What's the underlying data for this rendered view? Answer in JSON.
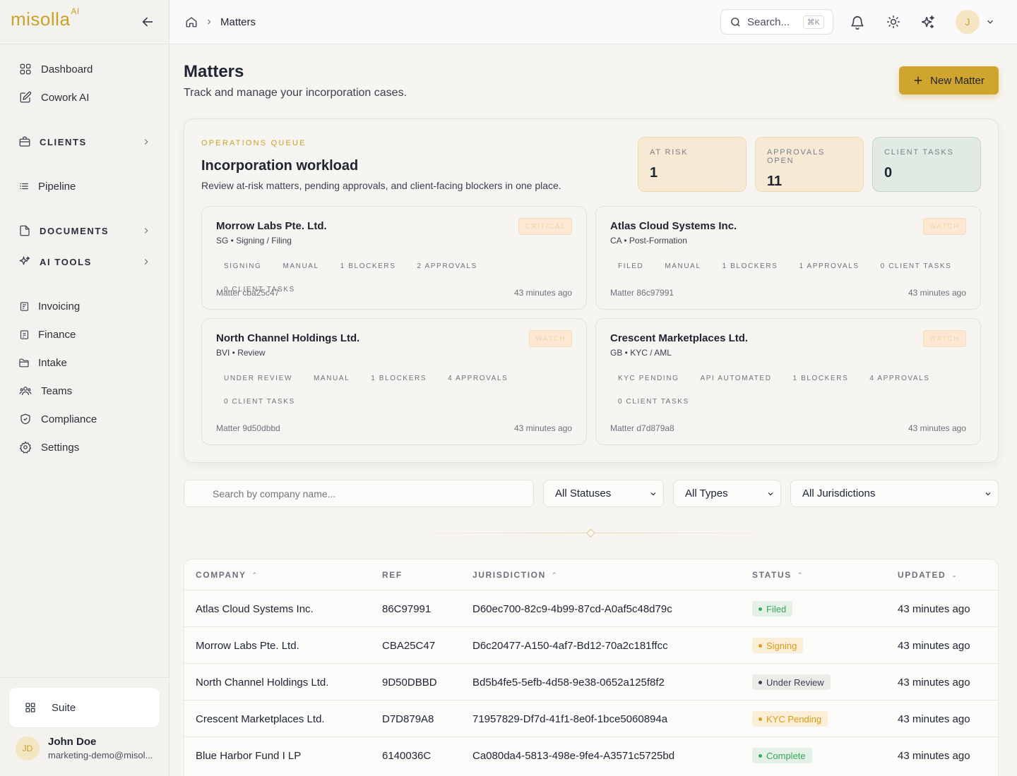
{
  "app": {
    "logo": "misolla",
    "logo_sup": "AI"
  },
  "sidebar": {
    "items": [
      {
        "label": "Dashboard",
        "icon": "grid-icon"
      },
      {
        "label": "Cowork AI",
        "icon": "pencil-square-icon"
      }
    ],
    "sections": [
      {
        "label": "CLIENTS",
        "icon": "briefcase-icon"
      },
      {
        "label": "DOCUMENTS",
        "icon": "document-icon"
      },
      {
        "label": "AI TOOLS",
        "icon": "sparkles-icon"
      }
    ],
    "pipeline": "Pipeline",
    "lower_items": [
      {
        "label": "Invoicing",
        "icon": "invoice-icon"
      },
      {
        "label": "Finance",
        "icon": "finance-icon"
      },
      {
        "label": "Intake",
        "icon": "folder-icon"
      },
      {
        "label": "Teams",
        "icon": "users-icon"
      },
      {
        "label": "Compliance",
        "icon": "shield-icon"
      },
      {
        "label": "Settings",
        "icon": "gear-icon"
      }
    ],
    "suite": "Suite",
    "user": {
      "initials": "JD",
      "name": "John Doe",
      "email": "marketing-demo@misol..."
    }
  },
  "topbar": {
    "breadcrumb": "Matters",
    "search_placeholder": "Search...",
    "search_kbd": "⌘K",
    "avatar_initial": "J"
  },
  "page": {
    "title": "Matters",
    "subtitle": "Track and manage your incorporation cases.",
    "new_button": "New Matter"
  },
  "queue": {
    "eyebrow": "OPERATIONS QUEUE",
    "title": "Incorporation workload",
    "subtitle": "Review at-risk matters, pending approvals, and client-facing blockers in one place.",
    "stats": [
      {
        "label": "AT RISK",
        "value": "1",
        "bg": "#f7ead4",
        "border": "#f0d9b0"
      },
      {
        "label": "APPROVALS OPEN",
        "value": "11",
        "bg": "#f7ead4",
        "border": "#f0d9b0"
      },
      {
        "label": "CLIENT TASKS",
        "value": "0",
        "bg": "#e2ebe3",
        "border": "#c6d6ca"
      }
    ],
    "cards": [
      {
        "name": "Morrow Labs Pte. Ltd.",
        "meta": "SG • Signing / Filing",
        "badge": "CRITICAL",
        "tags": [
          "SIGNING",
          "MANUAL",
          "1 BLOCKERS",
          "2 APPROVALS",
          "0 CLIENT TASKS"
        ],
        "ref": "Matter cba25c47",
        "ago": "43 minutes ago"
      },
      {
        "name": "Atlas Cloud Systems Inc.",
        "meta": "CA • Post-Formation",
        "badge": "WATCH",
        "tags": [
          "FILED",
          "MANUAL",
          "1 BLOCKERS",
          "1 APPROVALS",
          "0 CLIENT TASKS"
        ],
        "ref": "Matter 86c97991",
        "ago": "43 minutes ago"
      },
      {
        "name": "North Channel Holdings Ltd.",
        "meta": "BVI • Review",
        "badge": "WATCH",
        "tags": [
          "UNDER REVIEW",
          "MANUAL",
          "1 BLOCKERS",
          "4 APPROVALS",
          "0 CLIENT TASKS"
        ],
        "ref": "Matter 9d50dbbd",
        "ago": "43 minutes ago"
      },
      {
        "name": "Crescent Marketplaces Ltd.",
        "meta": "GB • KYC / AML",
        "badge": "WATCH",
        "tags": [
          "KYC PENDING",
          "API AUTOMATED",
          "1 BLOCKERS",
          "4 APPROVALS",
          "0 CLIENT TASKS"
        ],
        "ref": "Matter d7d879a8",
        "ago": "43 minutes ago"
      }
    ]
  },
  "filters": {
    "search_placeholder": "Search by company name...",
    "status": "All Statuses",
    "type": "All Types",
    "jurisdiction": "All Jurisdictions"
  },
  "table": {
    "columns": [
      "COMPANY",
      "REF",
      "JURISDICTION",
      "STATUS",
      "UPDATED"
    ],
    "rows": [
      {
        "company": "Atlas Cloud Systems Inc.",
        "ref": "86C97991",
        "jurisdiction": "D60ec700-82c9-4b99-87cd-A0af5c48d79c",
        "status": "Filed",
        "status_bg": "#e3f1e6",
        "status_fg": "#3aa55a",
        "updated": "43 minutes ago"
      },
      {
        "company": "Morrow Labs Pte. Ltd.",
        "ref": "CBA25C47",
        "jurisdiction": "D6c20477-A150-4af7-Bd12-70a2c181ffcc",
        "status": "Signing",
        "status_bg": "#fbeed6",
        "status_fg": "#d99a1c",
        "updated": "43 minutes ago"
      },
      {
        "company": "North Channel Holdings Ltd.",
        "ref": "9D50DBBD",
        "jurisdiction": "Bd5b4fe5-5efb-4d58-9e38-0652a125f8f2",
        "status": "Under Review",
        "status_bg": "#ecebe7",
        "status_fg": "#3b4050",
        "updated": "43 minutes ago"
      },
      {
        "company": "Crescent Marketplaces Ltd.",
        "ref": "D7D879A8",
        "jurisdiction": "71957829-Df7d-41f1-8e0f-1bce5060894a",
        "status": "KYC Pending",
        "status_bg": "#fbeed6",
        "status_fg": "#d99a1c",
        "updated": "43 minutes ago"
      },
      {
        "company": "Blue Harbor Fund I LP",
        "ref": "6140036C",
        "jurisdiction": "Ca080da4-5813-498e-9fe4-A3571c5725bd",
        "status": "Complete",
        "status_bg": "#e3f1e6",
        "status_fg": "#3aa55a",
        "updated": "43 minutes ago"
      }
    ]
  }
}
